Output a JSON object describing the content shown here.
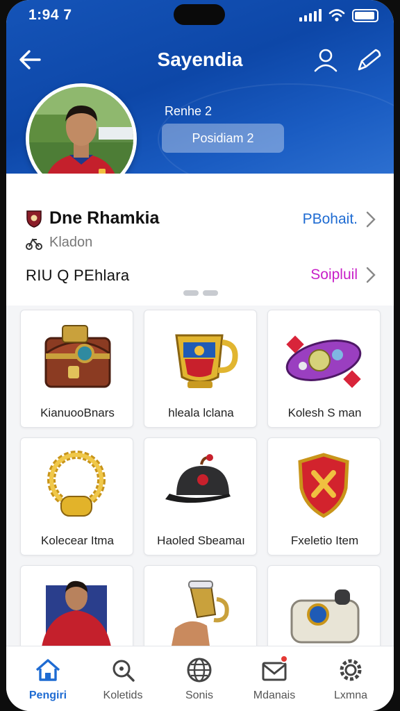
{
  "status_bar": {
    "time": "1:94 7"
  },
  "header": {
    "title": "Sayendia",
    "sub_label": "Renhe 2",
    "pill_label": "Posidiam 2"
  },
  "player": {
    "club_name": "Dne Rhamkia",
    "sub_info": "Kladon",
    "stat_line": "RIU Q PEhlara",
    "link_primary": "PBohait.",
    "link_secondary": "Soipluil"
  },
  "items": [
    {
      "label": "KianuooBnars",
      "icon": "treasure-chest-icon"
    },
    {
      "label": "hleala lclana",
      "icon": "trophy-cup-icon"
    },
    {
      "label": "Kolesh S man",
      "icon": "gem-ring-icon"
    },
    {
      "label": "Kolecear Itma",
      "icon": "gold-wreath-icon"
    },
    {
      "label": "Haoled Sbeamaı",
      "icon": "black-cap-icon"
    },
    {
      "label": "Fxeletio Item",
      "icon": "red-shield-icon"
    },
    {
      "label": "",
      "icon": "player-card-icon"
    },
    {
      "label": "",
      "icon": "golden-horn-icon"
    },
    {
      "label": "",
      "icon": "medal-box-icon"
    }
  ],
  "bottom_nav": [
    {
      "label": "Pengiri",
      "icon": "home-icon",
      "active": true
    },
    {
      "label": "Koletids",
      "icon": "search-icon",
      "active": false
    },
    {
      "label": "Sonis",
      "icon": "globe-icon",
      "active": false
    },
    {
      "label": "Mdanais",
      "icon": "mail-icon",
      "active": false
    },
    {
      "label": "Lxmna",
      "icon": "settings-icon",
      "active": false
    }
  ],
  "colors": {
    "header_blue": "#0d47a8",
    "link_blue": "#1e6bd2",
    "link_magenta": "#c81ec8",
    "badge_red": "#e53935"
  }
}
